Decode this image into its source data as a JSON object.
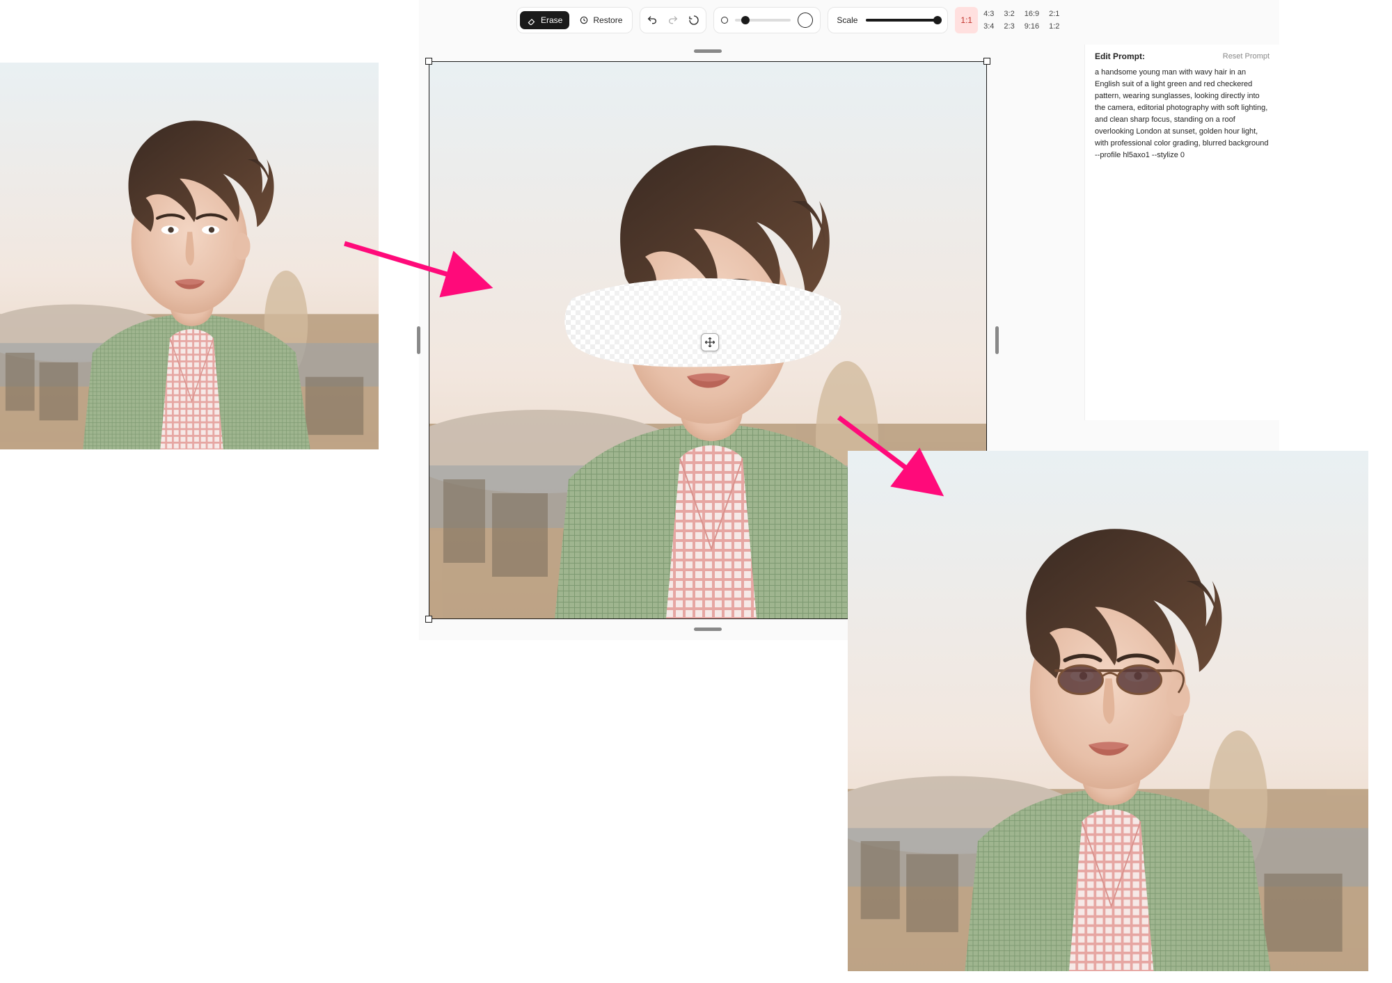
{
  "toolbar": {
    "erase_label": "Erase",
    "restore_label": "Restore",
    "scale_label": "Scale",
    "brush_value_pct": 18,
    "scale_value_pct": 100
  },
  "aspect": {
    "active": "1:1",
    "row1": [
      "4:3",
      "3:2",
      "16:9",
      "2:1"
    ],
    "row2": [
      "3:4",
      "2:3",
      "9:16",
      "1:2"
    ]
  },
  "prompt_panel": {
    "title": "Edit Prompt:",
    "reset": "Reset Prompt",
    "text": "a handsome young man with wavy hair in an English suit of a light green and red checkered pattern, wearing sunglasses, looking directly into the camera, editorial photography with soft lighting, and clean sharp focus, standing on a roof overlooking London at sunset, golden hour light, with professional color grading, blurred background --profile hl5axo1 --stylize 0"
  },
  "icons": {
    "erase": "erase-icon",
    "restore": "restore-icon",
    "undo": "undo-icon",
    "redo": "redo-icon",
    "reset": "reset-icon",
    "move": "move-icon"
  },
  "colors": {
    "accent_pink": "#ff0a7a",
    "ratio_active_bg": "#ffe0df",
    "ratio_active_fg": "#c03028"
  }
}
